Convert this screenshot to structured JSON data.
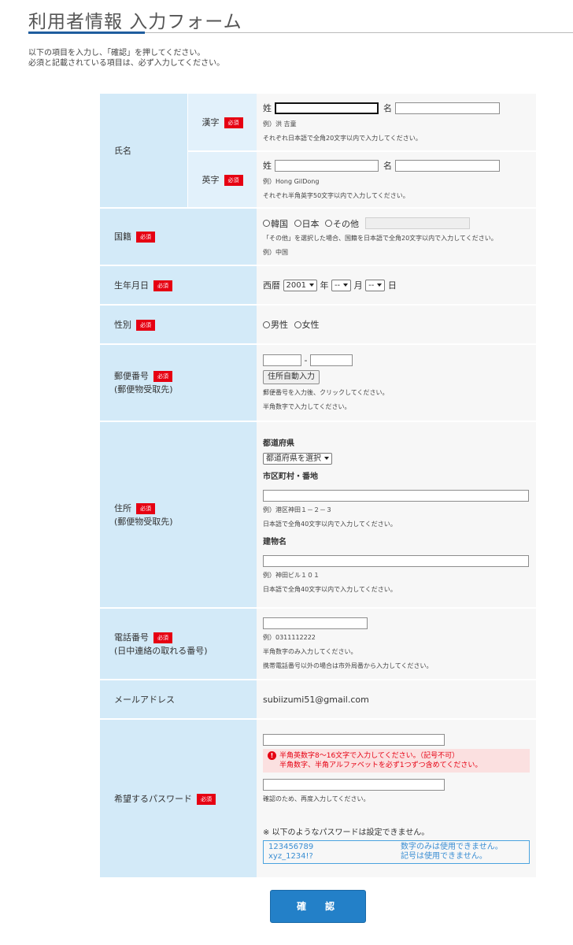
{
  "header": {
    "title": "利用者情報 入力フォーム",
    "intro_line1": "以下の項目を入力し、「確認」を押してください。",
    "intro_line2": "必須と記載されている項目は、必ず入力してください。"
  },
  "required_label": "必須",
  "name": {
    "label": "氏名",
    "kanji": {
      "label": "漢字",
      "sei_label": "姓",
      "mei_label": "名",
      "sei_value": "",
      "mei_value": "",
      "example": "例）洪 吉童",
      "note": "それぞれ日本語で全角20文字以内で入力してください。"
    },
    "english": {
      "label": "英字",
      "sei_label": "姓",
      "mei_label": "名",
      "sei_value": "",
      "mei_value": "",
      "example": "例）Hong GilDong",
      "note": "それぞれ半角英字50文字以内で入力してください。"
    }
  },
  "nationality": {
    "label": "国籍",
    "options": [
      "韓国",
      "日本",
      "その他"
    ],
    "other_value": "",
    "note": "「その他」を選択した場合、国籍を日本語で全角20文字以内で入力してください。",
    "example": "例）中国"
  },
  "birthdate": {
    "label": "生年月日",
    "era_label": "西暦",
    "year_value": "2001",
    "year_unit": "年",
    "month_value": "--",
    "month_unit": "月",
    "day_value": "--",
    "day_unit": "日"
  },
  "gender": {
    "label": "性別",
    "options": [
      "男性",
      "女性"
    ]
  },
  "postal": {
    "label": "郵便番号",
    "sublabel": "(郵便物受取先)",
    "separator": "-",
    "part1": "",
    "part2": "",
    "button": "住所自動入力",
    "note1": "郵便番号を入力後、クリックしてください。",
    "note2": "半角数字で入力してください。"
  },
  "address": {
    "label": "住所",
    "sublabel": "(郵便物受取先)",
    "pref_heading": "都道府県",
    "pref_select": "都道府県を選択",
    "city_heading": "市区町村・番地",
    "city_value": "",
    "city_example": "例）港区神田１－２－３",
    "city_note": "日本語で全角40文字以内で入力してください。",
    "building_heading": "建物名",
    "building_value": "",
    "building_example": "例）神田ビル１０１",
    "building_note": "日本語で全角40文字以内で入力してください。"
  },
  "phone": {
    "label": "電話番号",
    "sublabel": "(日中連絡の取れる番号)",
    "value": "",
    "example": "例）0311112222",
    "note1": "半角数字のみ入力してください。",
    "note2": "携帯電話番号以外の場合は市外局番から入力してください。"
  },
  "email": {
    "label": "メールアドレス",
    "value": "subiizumi51@gmail.com"
  },
  "password": {
    "label": "希望するパスワード",
    "value": "",
    "error_line1": "半角英数字8〜16文字で入力してください。（記号不可）",
    "error_line2": "半角数字、半角アルファベットを必ず1つずつ含めてください。",
    "confirm_value": "",
    "confirm_note": "確認のため、再度入力してください。",
    "warning": "※ 以下のようなパスワードは設定できません。",
    "examples": [
      {
        "pw": "123456789",
        "reason": "数字のみは使用できません。"
      },
      {
        "pw": "xyz_1234!?",
        "reason": "記号は使用できません。"
      }
    ]
  },
  "confirm_button": "確　認",
  "colors": {
    "accent": "#2380c8",
    "required": "#e60012",
    "header_bg": "#d3eaf8",
    "link": "#3a8ed3"
  }
}
